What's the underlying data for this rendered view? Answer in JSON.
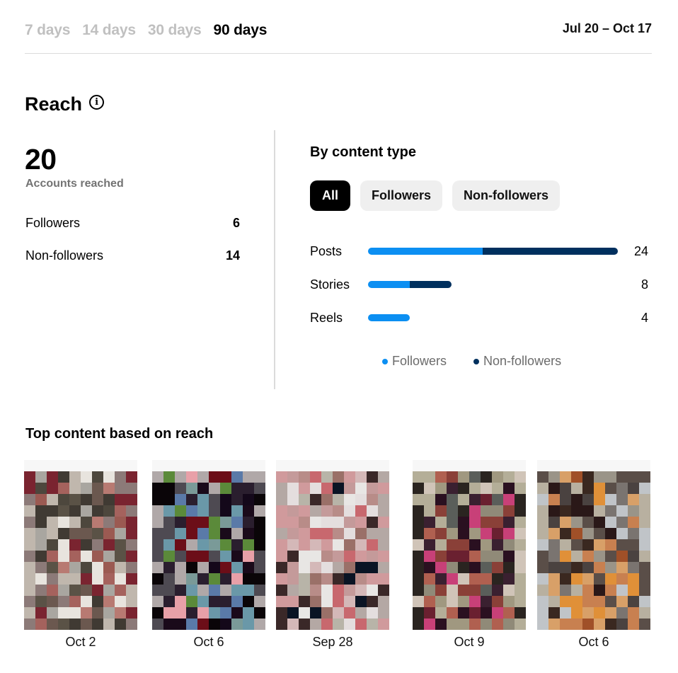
{
  "range_tabs": [
    {
      "label": "7 days",
      "active": false
    },
    {
      "label": "14 days",
      "active": false
    },
    {
      "label": "30 days",
      "active": false
    },
    {
      "label": "90 days",
      "active": true
    }
  ],
  "date_range": "Jul 20 – Oct 17",
  "reach": {
    "title": "Reach",
    "info_icon": "info-icon",
    "accounts_reached": "20",
    "accounts_reached_label": "Accounts reached",
    "breakdown": [
      {
        "label": "Followers",
        "value": "6"
      },
      {
        "label": "Non-followers",
        "value": "14"
      }
    ]
  },
  "content_type": {
    "title": "By content type",
    "filters": [
      {
        "label": "All",
        "active": true
      },
      {
        "label": "Followers",
        "active": false
      },
      {
        "label": "Non-followers",
        "active": false
      }
    ],
    "colors": {
      "followers": "#0c8ff2",
      "non_followers": "#00305e"
    },
    "max": 24,
    "rows": [
      {
        "label": "Posts",
        "total": "24",
        "followers": 11,
        "non_followers": 13
      },
      {
        "label": "Stories",
        "total": "8",
        "followers": 4,
        "non_followers": 4
      },
      {
        "label": "Reels",
        "total": "4",
        "followers": 4,
        "non_followers": 0
      }
    ],
    "legend": [
      {
        "label": "Followers",
        "color": "#0c8ff2"
      },
      {
        "label": "Non-followers",
        "color": "#00305e"
      }
    ]
  },
  "top_content": {
    "title": "Top content based on reach",
    "items": [
      {
        "date": "Oct 2",
        "palette": [
          "#a5625d",
          "#5a5246",
          "#4d473d",
          "#9b5a52",
          "#b87a72",
          "#6b584f",
          "#a9a6a0",
          "#e8e4de",
          "#403a33",
          "#7a2430",
          "#c0b7ad",
          "#8c7a78"
        ]
      },
      {
        "date": "Oct 6",
        "palette": [
          "#14081a",
          "#6c0e18",
          "#1a0a1a",
          "#5b8a3a",
          "#6a98a8",
          "#5a7aa8",
          "#2a1e2e",
          "#e8a0a8",
          "#7a9a98",
          "#0a0508",
          "#4e4a52",
          "#b0a8a8"
        ]
      },
      {
        "date": "Sep 28",
        "palette": [
          "#b8b4a8",
          "#c49a9a",
          "#b88c88",
          "#d4b8b8",
          "#e4dede",
          "#0a1424",
          "#c8686e",
          "#9a7068",
          "#e8e6e4",
          "#b4a8a4",
          "#3a2828",
          "#d09a9c"
        ]
      },
      {
        "date": "Oct 9",
        "palette": [
          "#a09880",
          "#3a2030",
          "#5a5e5a",
          "#6a2030",
          "#b06050",
          "#c84078",
          "#8a4038",
          "#2a1020",
          "#908a78",
          "#2a2420",
          "#b4ae98",
          "#d0c4b8"
        ]
      },
      {
        "date": "Oct 6",
        "palette": [
          "#7a7470",
          "#3a2820",
          "#4a4240",
          "#e09038",
          "#c88050",
          "#a05028",
          "#2a1818",
          "#d8a068",
          "#9a9488",
          "#b8b0a0",
          "#5a4e48",
          "#c0c4c8"
        ]
      }
    ]
  }
}
